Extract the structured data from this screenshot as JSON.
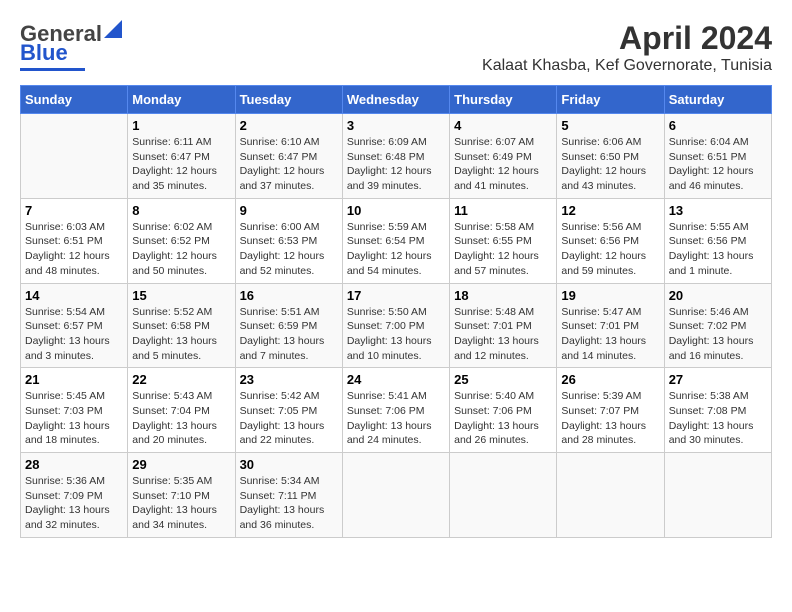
{
  "header": {
    "logo_general": "General",
    "logo_blue": "Blue",
    "title": "April 2024",
    "subtitle": "Kalaat Khasba, Kef Governorate, Tunisia"
  },
  "calendar": {
    "weekdays": [
      "Sunday",
      "Monday",
      "Tuesday",
      "Wednesday",
      "Thursday",
      "Friday",
      "Saturday"
    ],
    "weeks": [
      [
        {
          "day": "",
          "info": ""
        },
        {
          "day": "1",
          "info": "Sunrise: 6:11 AM\nSunset: 6:47 PM\nDaylight: 12 hours\nand 35 minutes."
        },
        {
          "day": "2",
          "info": "Sunrise: 6:10 AM\nSunset: 6:47 PM\nDaylight: 12 hours\nand 37 minutes."
        },
        {
          "day": "3",
          "info": "Sunrise: 6:09 AM\nSunset: 6:48 PM\nDaylight: 12 hours\nand 39 minutes."
        },
        {
          "day": "4",
          "info": "Sunrise: 6:07 AM\nSunset: 6:49 PM\nDaylight: 12 hours\nand 41 minutes."
        },
        {
          "day": "5",
          "info": "Sunrise: 6:06 AM\nSunset: 6:50 PM\nDaylight: 12 hours\nand 43 minutes."
        },
        {
          "day": "6",
          "info": "Sunrise: 6:04 AM\nSunset: 6:51 PM\nDaylight: 12 hours\nand 46 minutes."
        }
      ],
      [
        {
          "day": "7",
          "info": "Sunrise: 6:03 AM\nSunset: 6:51 PM\nDaylight: 12 hours\nand 48 minutes."
        },
        {
          "day": "8",
          "info": "Sunrise: 6:02 AM\nSunset: 6:52 PM\nDaylight: 12 hours\nand 50 minutes."
        },
        {
          "day": "9",
          "info": "Sunrise: 6:00 AM\nSunset: 6:53 PM\nDaylight: 12 hours\nand 52 minutes."
        },
        {
          "day": "10",
          "info": "Sunrise: 5:59 AM\nSunset: 6:54 PM\nDaylight: 12 hours\nand 54 minutes."
        },
        {
          "day": "11",
          "info": "Sunrise: 5:58 AM\nSunset: 6:55 PM\nDaylight: 12 hours\nand 57 minutes."
        },
        {
          "day": "12",
          "info": "Sunrise: 5:56 AM\nSunset: 6:56 PM\nDaylight: 12 hours\nand 59 minutes."
        },
        {
          "day": "13",
          "info": "Sunrise: 5:55 AM\nSunset: 6:56 PM\nDaylight: 13 hours\nand 1 minute."
        }
      ],
      [
        {
          "day": "14",
          "info": "Sunrise: 5:54 AM\nSunset: 6:57 PM\nDaylight: 13 hours\nand 3 minutes."
        },
        {
          "day": "15",
          "info": "Sunrise: 5:52 AM\nSunset: 6:58 PM\nDaylight: 13 hours\nand 5 minutes."
        },
        {
          "day": "16",
          "info": "Sunrise: 5:51 AM\nSunset: 6:59 PM\nDaylight: 13 hours\nand 7 minutes."
        },
        {
          "day": "17",
          "info": "Sunrise: 5:50 AM\nSunset: 7:00 PM\nDaylight: 13 hours\nand 10 minutes."
        },
        {
          "day": "18",
          "info": "Sunrise: 5:48 AM\nSunset: 7:01 PM\nDaylight: 13 hours\nand 12 minutes."
        },
        {
          "day": "19",
          "info": "Sunrise: 5:47 AM\nSunset: 7:01 PM\nDaylight: 13 hours\nand 14 minutes."
        },
        {
          "day": "20",
          "info": "Sunrise: 5:46 AM\nSunset: 7:02 PM\nDaylight: 13 hours\nand 16 minutes."
        }
      ],
      [
        {
          "day": "21",
          "info": "Sunrise: 5:45 AM\nSunset: 7:03 PM\nDaylight: 13 hours\nand 18 minutes."
        },
        {
          "day": "22",
          "info": "Sunrise: 5:43 AM\nSunset: 7:04 PM\nDaylight: 13 hours\nand 20 minutes."
        },
        {
          "day": "23",
          "info": "Sunrise: 5:42 AM\nSunset: 7:05 PM\nDaylight: 13 hours\nand 22 minutes."
        },
        {
          "day": "24",
          "info": "Sunrise: 5:41 AM\nSunset: 7:06 PM\nDaylight: 13 hours\nand 24 minutes."
        },
        {
          "day": "25",
          "info": "Sunrise: 5:40 AM\nSunset: 7:06 PM\nDaylight: 13 hours\nand 26 minutes."
        },
        {
          "day": "26",
          "info": "Sunrise: 5:39 AM\nSunset: 7:07 PM\nDaylight: 13 hours\nand 28 minutes."
        },
        {
          "day": "27",
          "info": "Sunrise: 5:38 AM\nSunset: 7:08 PM\nDaylight: 13 hours\nand 30 minutes."
        }
      ],
      [
        {
          "day": "28",
          "info": "Sunrise: 5:36 AM\nSunset: 7:09 PM\nDaylight: 13 hours\nand 32 minutes."
        },
        {
          "day": "29",
          "info": "Sunrise: 5:35 AM\nSunset: 7:10 PM\nDaylight: 13 hours\nand 34 minutes."
        },
        {
          "day": "30",
          "info": "Sunrise: 5:34 AM\nSunset: 7:11 PM\nDaylight: 13 hours\nand 36 minutes."
        },
        {
          "day": "",
          "info": ""
        },
        {
          "day": "",
          "info": ""
        },
        {
          "day": "",
          "info": ""
        },
        {
          "day": "",
          "info": ""
        }
      ]
    ]
  }
}
